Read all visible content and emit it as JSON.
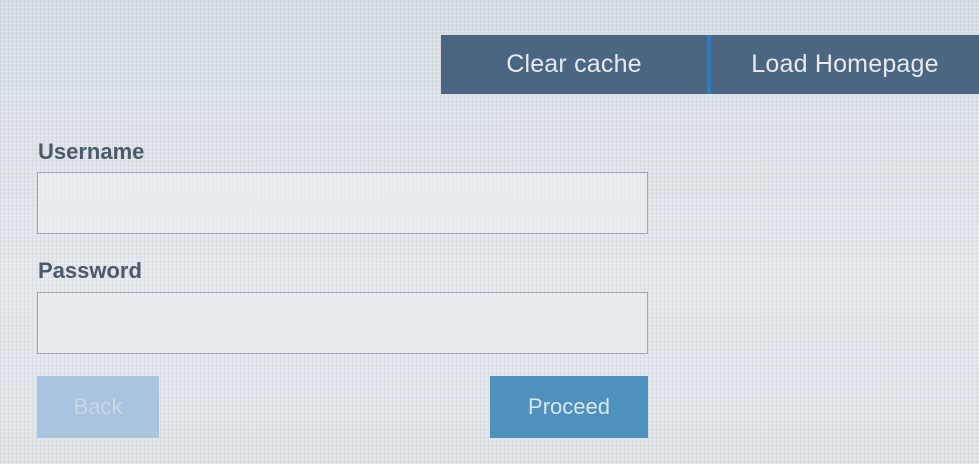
{
  "toolbar": {
    "clear_cache_label": "Clear cache",
    "load_homepage_label": "Load Homepage"
  },
  "login_form": {
    "username_label": "Username",
    "username_value": "",
    "password_label": "Password",
    "password_value": "",
    "back_label": "Back",
    "proceed_label": "Proceed"
  },
  "colors": {
    "background": "#dfe4e8",
    "toolbar_button": "#4b6583",
    "toolbar_divider": "#2f7fc0",
    "back_button_disabled": "#a9c4de",
    "proceed_button": "#4f91bd",
    "label_text": "#4a5a6a"
  }
}
